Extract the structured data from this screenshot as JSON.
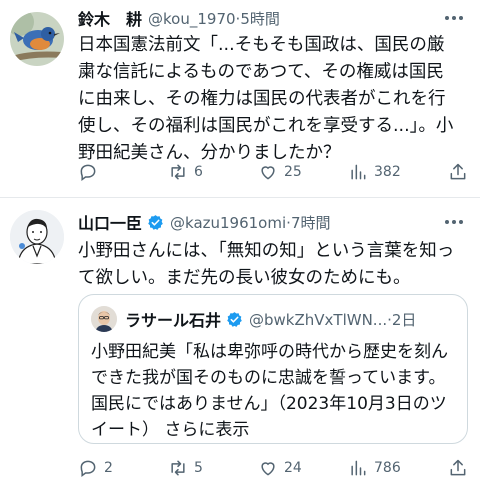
{
  "tweet1": {
    "name": "鈴木　耕",
    "handle": "@kou_1970",
    "time": "5時間",
    "text": "日本国憲法前文「...そもそも国政は、国民の厳粛な信託によるものであつて、その権威は国民に由来し、その権力は国民の代表者がこれを行使し、その福利は国民がこれを享受する...」。小野田紀美さん、分かりましたか？",
    "reply_count": "",
    "retweet_count": "6",
    "like_count": "25",
    "view_count": "382"
  },
  "tweet2": {
    "name": "山口一臣",
    "handle": "@kazu1961omi",
    "time": "7時間",
    "text": "小野田さんには、「無知の知」という言葉を知って欲しい。まだ先の長い彼女のためにも。",
    "reply_count": "2",
    "retweet_count": "5",
    "like_count": "24",
    "view_count": "786",
    "quote": {
      "name": "ラサール石井",
      "handle": "@bwkZhVxTlWN...",
      "time": "2日",
      "text": "小野田紀美「私は卑弥呼の時代から歴史を刻んできた我が国そのものに忠誠を誓っています。国民にではありません」（2023年10月3日のツイート） さらに表示"
    }
  },
  "colors": {
    "text": "#0f1419",
    "muted": "#536471",
    "verified": "#1d9bf0",
    "border": "#cfd9de"
  },
  "icons": [
    "reply-icon",
    "retweet-icon",
    "like-icon",
    "views-icon",
    "share-icon",
    "more-icon",
    "verified-icon"
  ]
}
